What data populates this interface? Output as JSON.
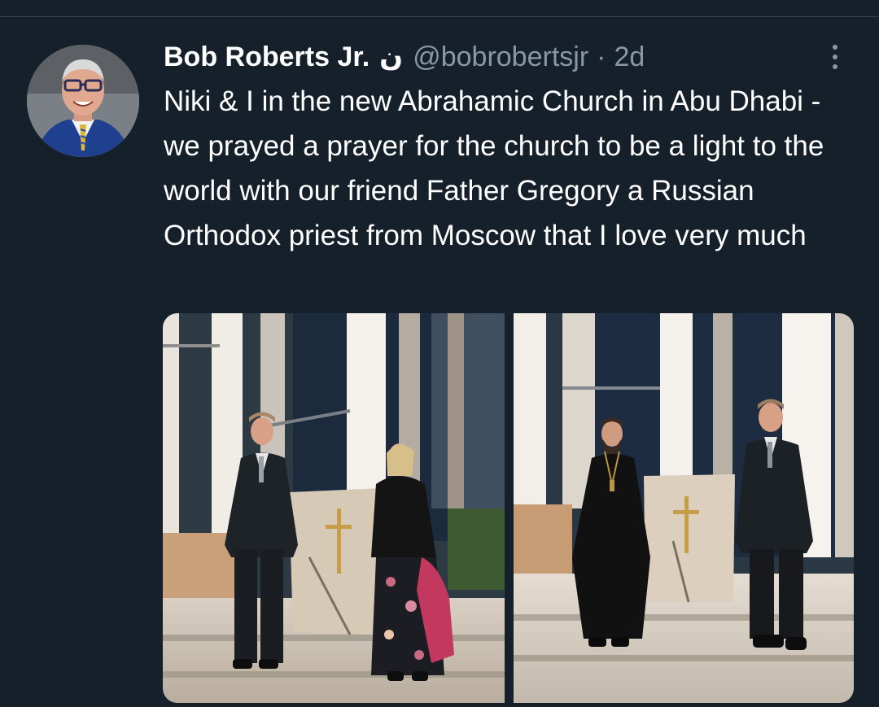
{
  "tweet": {
    "author": {
      "display_name": "Bob Roberts Jr.",
      "name_glyph": "ن",
      "handle": "@bobrobertsjr"
    },
    "separator": "·",
    "timestamp": "2d",
    "text": "Niki & I in the new Abrahamic Church in Abu Dhabi - we prayed a prayer for the church to be a light to the world with our friend Father Gregory a Russian Orthodox priest from Moscow that I love very much",
    "media": [
      {
        "icon": "photo-left"
      },
      {
        "icon": "photo-right"
      }
    ]
  },
  "colors": {
    "background": "#15202b",
    "text_primary": "#ffffff",
    "text_secondary": "#8899a6",
    "divider": "#38444d"
  },
  "icons": {
    "more": "more-vertical-icon"
  }
}
